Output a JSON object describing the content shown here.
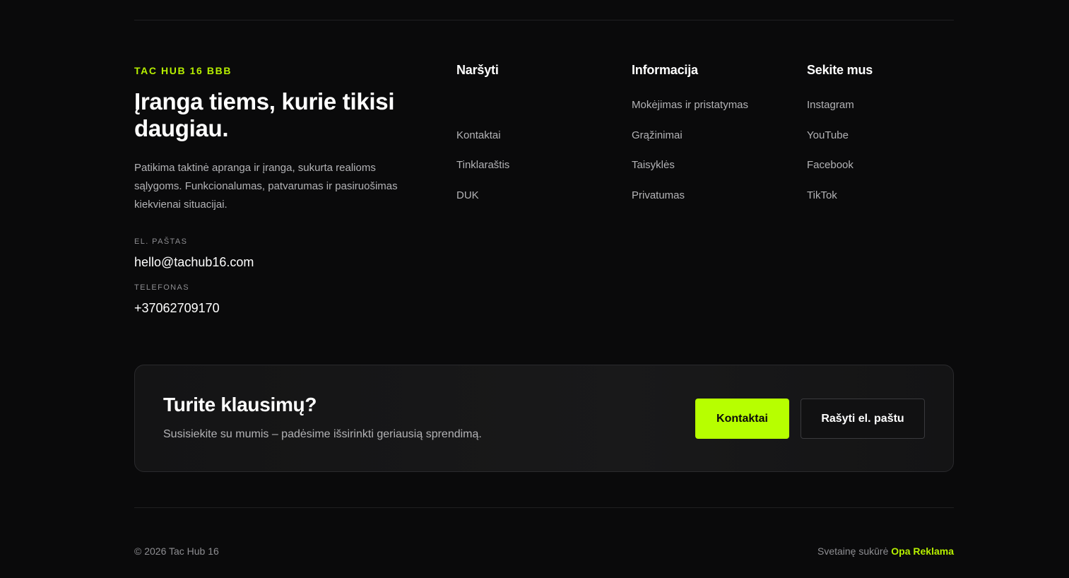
{
  "brand": {
    "eyebrow": "TAC HUB 16 BBB",
    "headline_line1": "Įranga tiems, kurie tikisi",
    "headline_line2": "daugiau.",
    "description": "Patikima taktinė apranga ir įranga, sukurta realioms sąlygoms. Funkcionalumas, patvarumas ir pasiruošimas kiekvienai situacijai.",
    "email_label": "EL. PAŠTAS",
    "email": "hello@tachub16.com",
    "phone_label": "TELEFONAS",
    "phone": "+37062709170"
  },
  "columns": {
    "nav": {
      "title": "Naršyti",
      "items": [
        "Kontaktai",
        "Tinklaraštis",
        "DUK"
      ]
    },
    "info": {
      "title": "Informacija",
      "items": [
        "Mokėjimas ir pristatymas",
        "Grąžinimai",
        "Taisyklės",
        "Privatumas"
      ]
    },
    "social": {
      "title": "Sekite mus",
      "items": [
        "Instagram",
        "YouTube",
        "Facebook",
        "TikTok"
      ]
    }
  },
  "cta": {
    "title": "Turite klausimų?",
    "subtitle": "Susisiekite su mumis – padėsime išsirinkti geriausią sprendimą.",
    "primary_label": "Kontaktai",
    "secondary_label": "Rašyti el. paštu"
  },
  "footer": {
    "copyright": "© 2026 Tac Hub 16",
    "credit_prefix": "Svetainę sukūrė ",
    "credit_link": "Opa Reklama"
  },
  "colors": {
    "background": "#0a0a0b",
    "accent": "#b7ff00"
  }
}
